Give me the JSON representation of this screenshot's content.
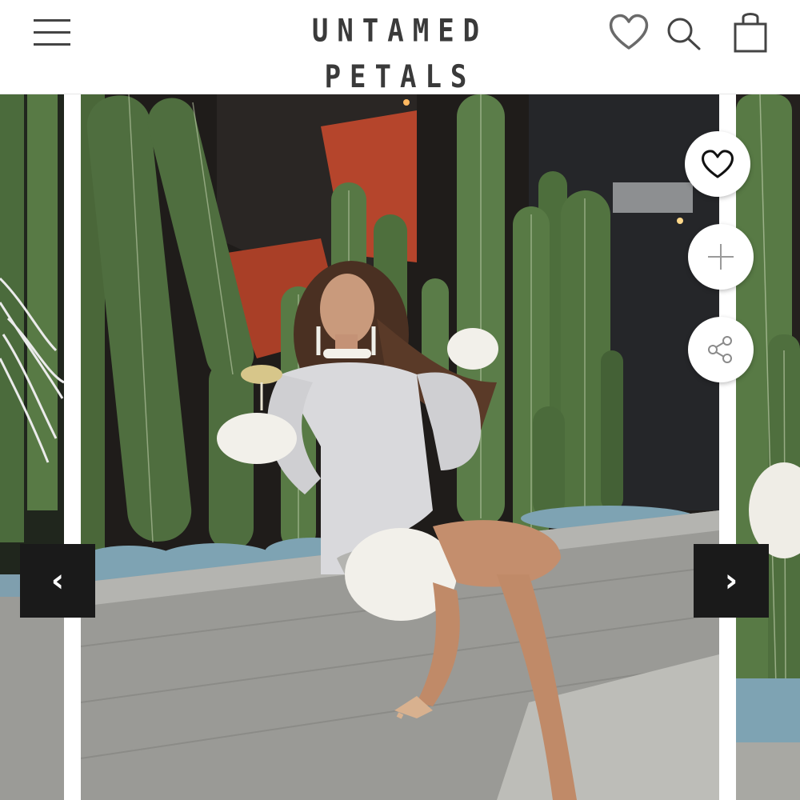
{
  "header": {
    "brand": "UNTAMED PETALS",
    "icons": {
      "menu": "hamburger-menu-icon",
      "wishlist": "heart-outline-icon",
      "search": "search-icon",
      "bag": "shopping-bag-icon"
    }
  },
  "carousel": {
    "actions": {
      "wishlist": "heart-outline-icon",
      "add": "plus-icon",
      "share": "share-icon"
    },
    "prev_glyph": "‹",
    "next_glyph": "›"
  },
  "colors": {
    "brand_text": "#3a3a3a",
    "arrow_bg": "#1a1a1a",
    "cactus": "#4f6e3f",
    "wall": "#9a9a96",
    "dress": "#d9d9dc"
  }
}
